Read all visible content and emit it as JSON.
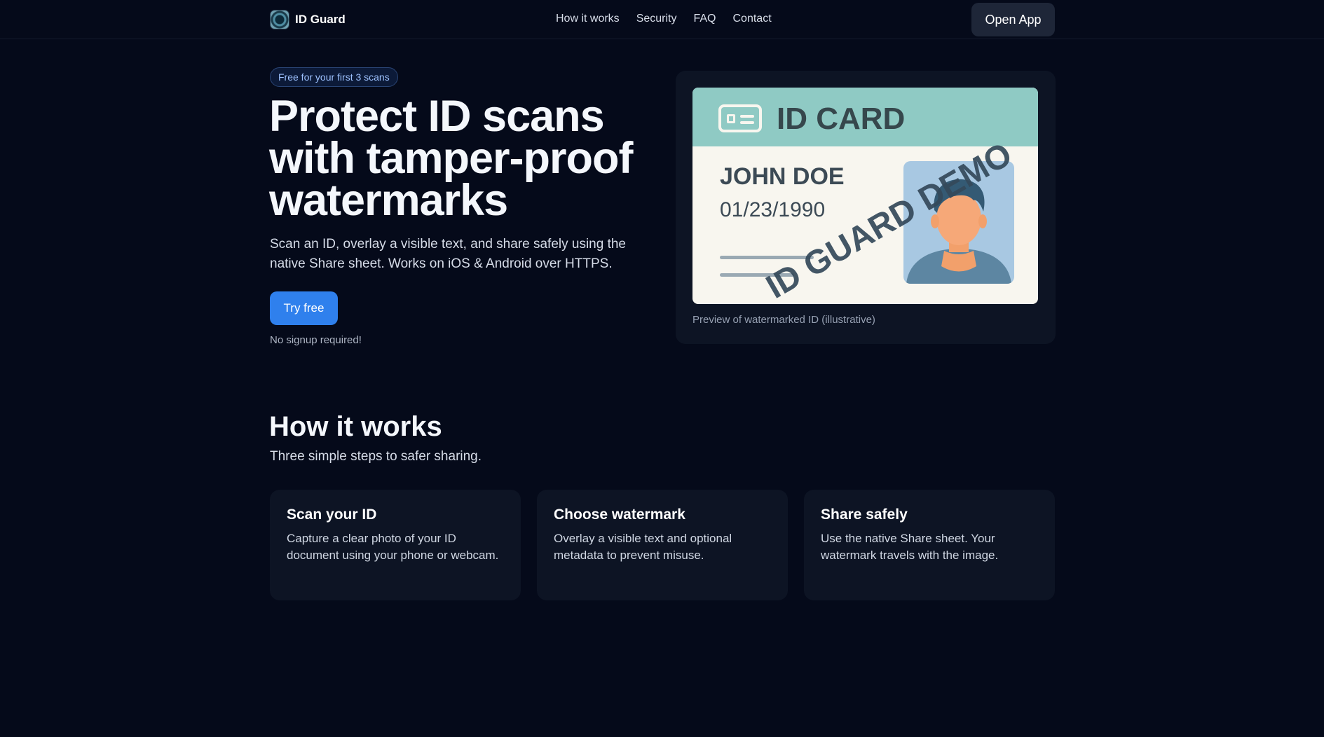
{
  "nav": {
    "brand": "ID Guard",
    "links": [
      "How it works",
      "Security",
      "FAQ",
      "Contact"
    ],
    "cta": "Open App"
  },
  "hero": {
    "badge": "Free for your first 3 scans",
    "title_lines": [
      "Protect ID scans",
      "with tamper-proof",
      "watermarks"
    ],
    "subtitle": "Scan an ID, overlay a visible text, and share safely using the native Share sheet. Works on iOS & Android over HTTPS.",
    "button": "Try free",
    "note": "No signup required!"
  },
  "preview": {
    "card_title": "ID CARD",
    "name": "JOHN DOE",
    "dob": "01/23/1990",
    "watermark": "ID GUARD DEMO",
    "caption": "Preview of watermarked ID (illustrative)",
    "colors": {
      "header": "#8fcac4",
      "card": "#f8f6ef",
      "photo_bg": "#a8c8e2"
    }
  },
  "how_it_works": {
    "title": "How it works",
    "subtitle": "Three simple steps to safer sharing.",
    "steps": [
      {
        "title": "Scan your ID",
        "desc": "Capture a clear photo of your ID document using your phone or webcam."
      },
      {
        "title": "Choose watermark",
        "desc": "Overlay a visible text and optional metadata to prevent misuse."
      },
      {
        "title": "Share safely",
        "desc": "Use the native Share sheet. Your watermark travels with the image."
      }
    ]
  },
  "icons": {
    "logo": "camera-lens-icon",
    "id": "id-card-icon",
    "avatar": "person-avatar-icon"
  },
  "colors": {
    "background": "#050a1a",
    "accent": "#2f80ed",
    "panel": "#0d1424"
  }
}
